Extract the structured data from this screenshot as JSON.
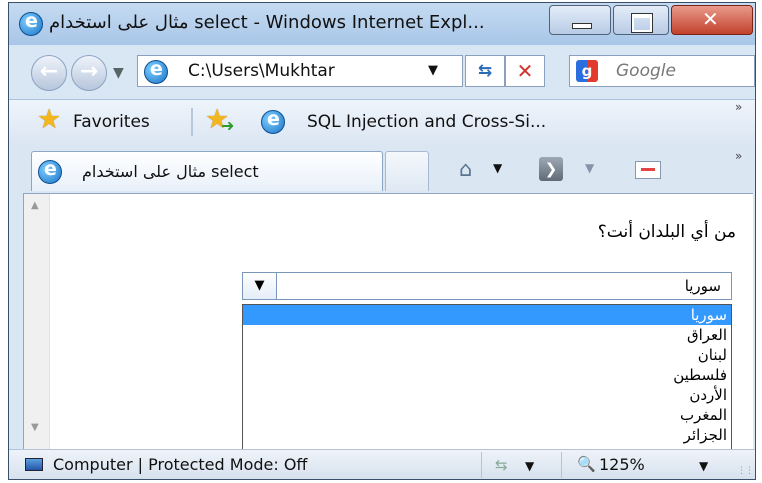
{
  "window": {
    "title": "مثال على استخدام select - Windows Internet Expl...",
    "buttons": {
      "minimize": "minimize-icon",
      "maximize": "maximize-icon",
      "close": "close-icon"
    }
  },
  "navigation": {
    "address": "C:\\Users\\Mukhtar",
    "search_placeholder": "Google"
  },
  "favorites_bar": {
    "favorites_label": "Favorites",
    "items": [
      {
        "label": "SQL Injection and Cross-Si..."
      }
    ],
    "more": "»"
  },
  "tabs": [
    {
      "title": "مثال على استخدام select"
    }
  ],
  "command_bar": {
    "icons": [
      "home-icon",
      "feeds-icon",
      "read-mail-icon"
    ],
    "more": "»"
  },
  "page": {
    "question": "من أي البلدان أنت؟",
    "select": {
      "value": "سوريا",
      "options": [
        "سوريا",
        "العراق",
        "لبنان",
        "فلسطين",
        "الأردن",
        "المغرب",
        "الجزائر"
      ],
      "highlighted_index": 0
    }
  },
  "status_bar": {
    "zone": "Computer | Protected Mode: Off",
    "zoom": "125%"
  },
  "colors": {
    "highlight": "#3399ff",
    "close_button": "#c2412b"
  }
}
